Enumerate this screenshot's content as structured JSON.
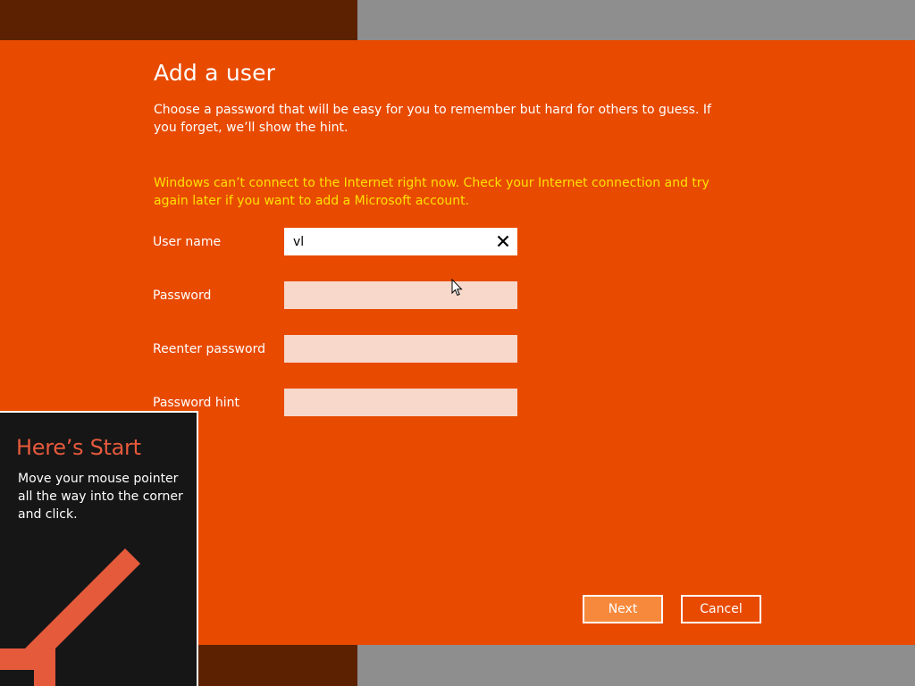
{
  "dialog": {
    "title": "Add a user",
    "subtitle": "Choose a password that will be easy for you to remember but hard for others to guess. If you forget, we’ll show the hint.",
    "warning": "Windows can’t connect to the Internet right now. Check your Internet connection and try again later if you want to add a Microsoft account."
  },
  "form": {
    "username": {
      "label": "User name",
      "value": "vl"
    },
    "password": {
      "label": "Password",
      "value": ""
    },
    "reenter_password": {
      "label": "Reenter password",
      "value": ""
    },
    "password_hint": {
      "label": "Password hint",
      "value": ""
    }
  },
  "buttons": {
    "next": "Next",
    "cancel": "Cancel"
  },
  "start_tip": {
    "title": "Here’s Start",
    "text": "Move your mouse pointer all the way into the corner and click."
  },
  "colors": {
    "accent": "#e84a00",
    "warning_text": "#ffe100",
    "tip_title": "#e65a3c",
    "tip_bg": "#161616",
    "next_button": "#f7893c"
  },
  "icons": [
    "clear-icon",
    "mouse-pointer-icon",
    "corner-arrow-icon"
  ]
}
